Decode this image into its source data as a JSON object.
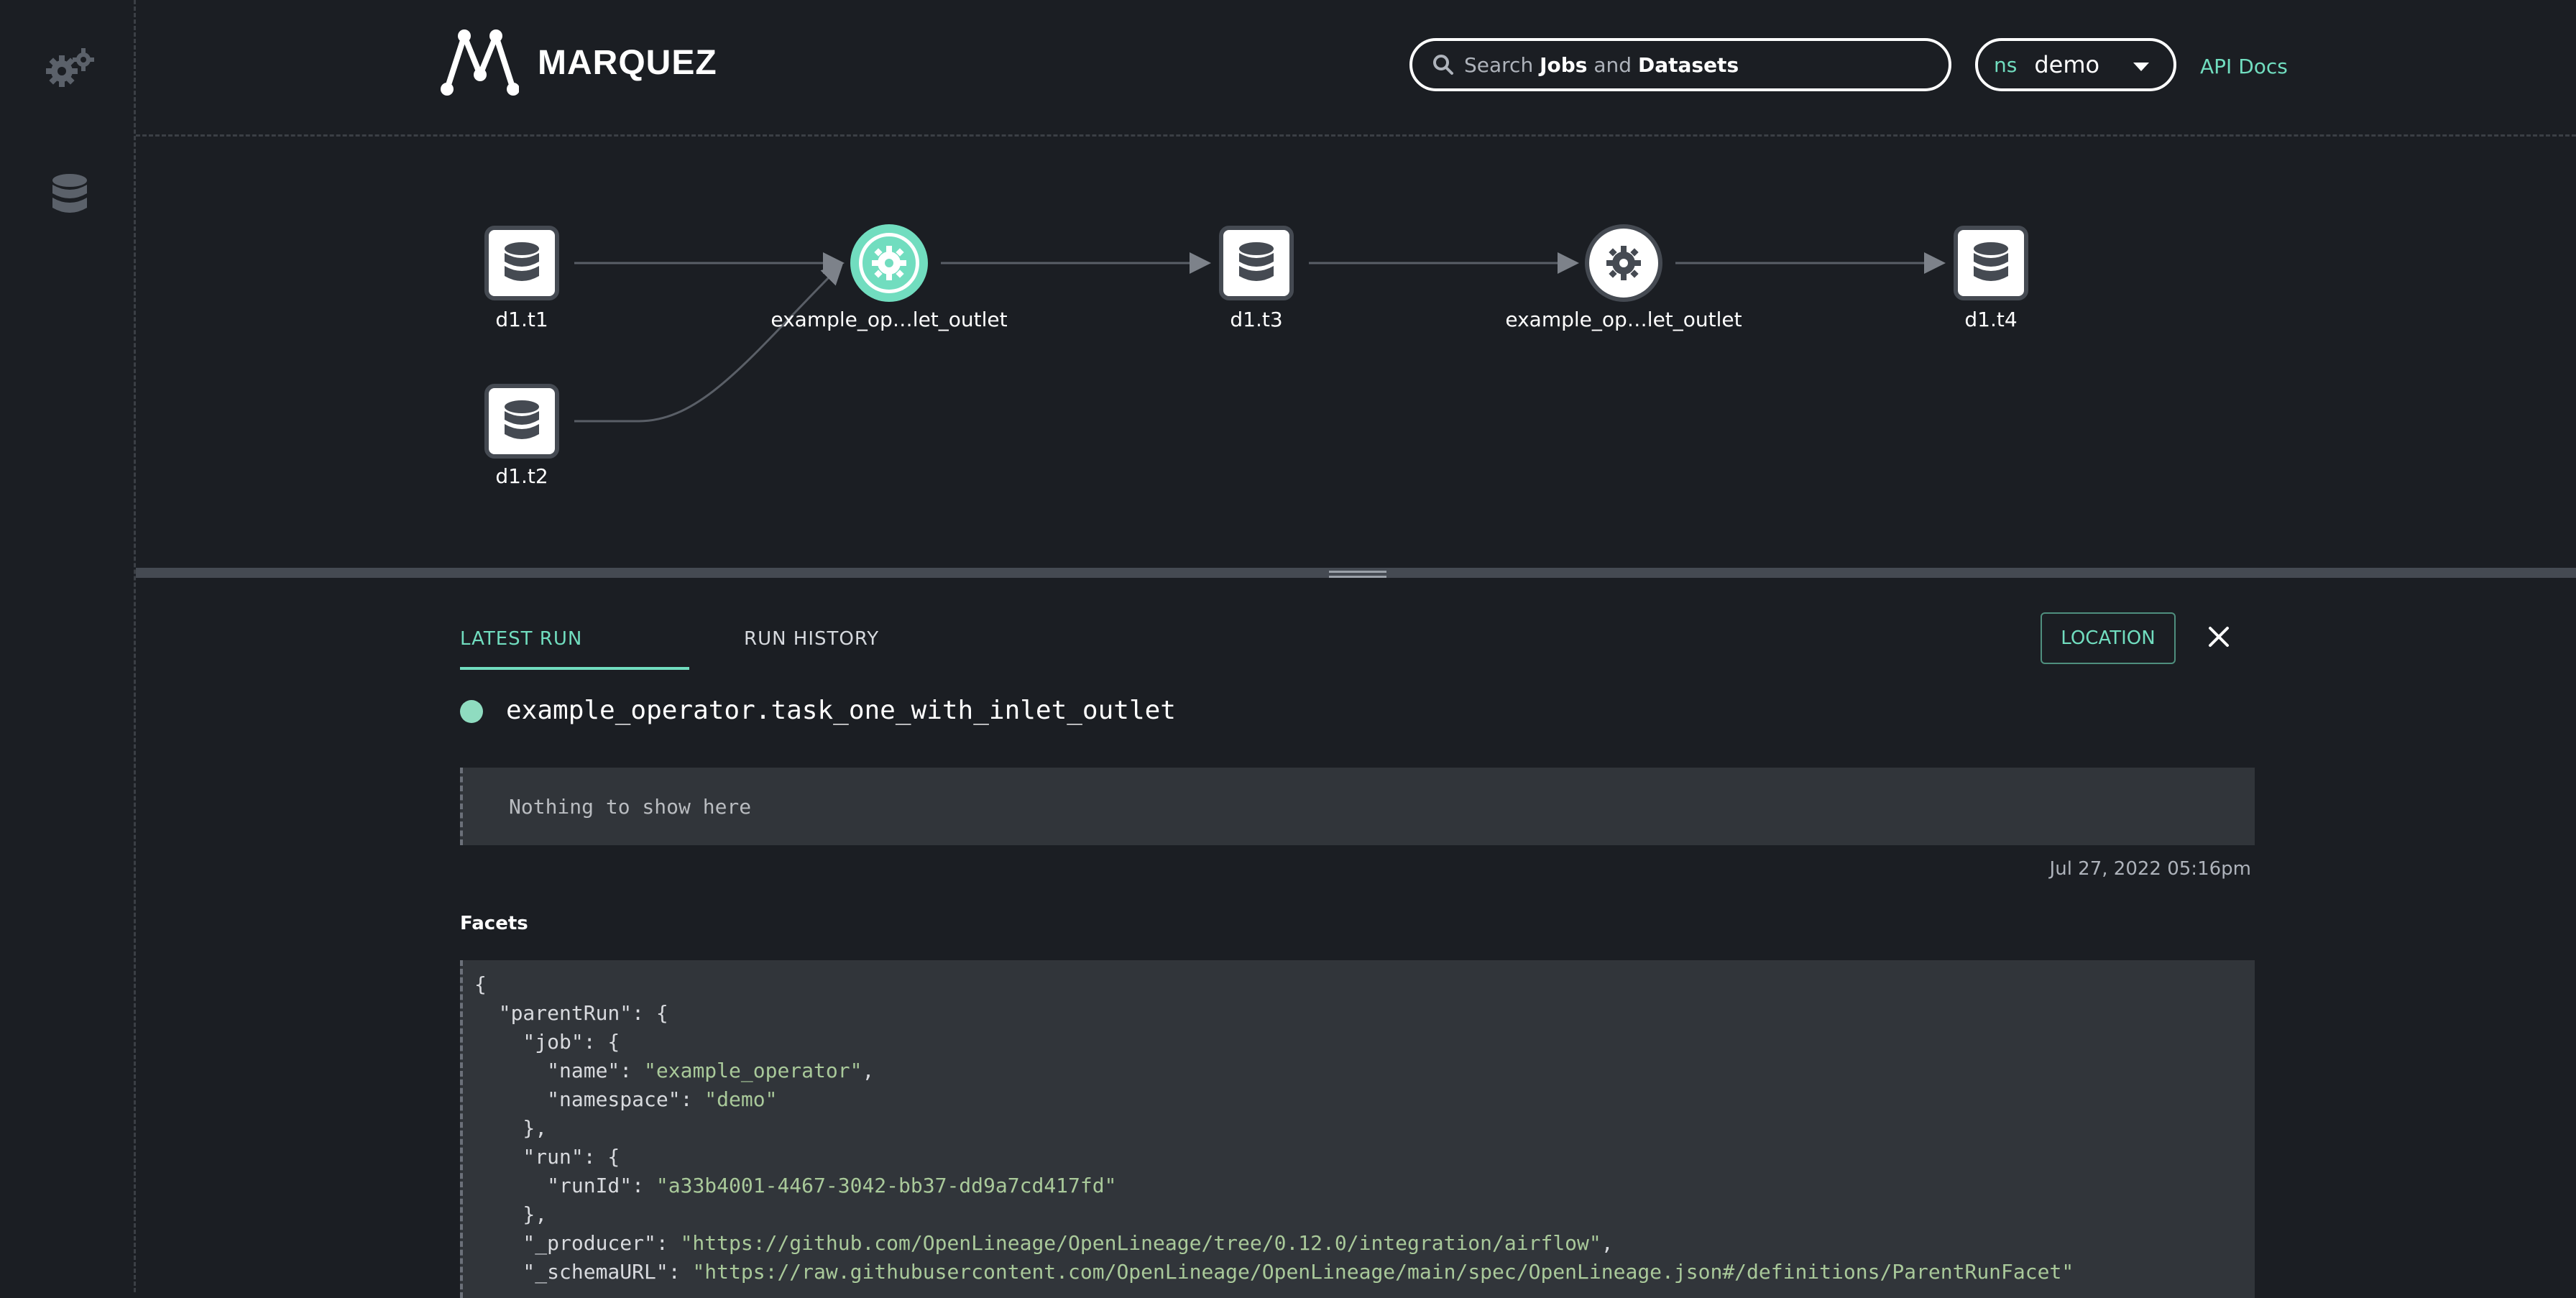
{
  "app": {
    "name": "MARQUEZ"
  },
  "search": {
    "prefix": "Search",
    "bold1": "Jobs",
    "mid": "and",
    "bold2": "Datasets"
  },
  "namespace": {
    "label": "ns",
    "value": "demo"
  },
  "header": {
    "api_docs": "API Docs"
  },
  "graph": {
    "nodes": [
      {
        "label": "d1.t1"
      },
      {
        "label": "d1.t2"
      },
      {
        "label": "example_op…let_outlet"
      },
      {
        "label": "d1.t3"
      },
      {
        "label": "example_op…let_outlet"
      },
      {
        "label": "d1.t4"
      }
    ]
  },
  "panel": {
    "tabs": [
      {
        "label": "LATEST RUN"
      },
      {
        "label": "RUN HISTORY"
      }
    ],
    "location_button": "LOCATION",
    "job_name": "example_operator.task_one_with_inlet_outlet",
    "empty_text": "Nothing to show here",
    "timestamp": "Jul 27, 2022 05:16pm",
    "facets_heading": "Facets",
    "facets_lines": [
      {
        "pre": "{",
        "str": "",
        "post": ""
      },
      {
        "pre": "  \"parentRun\": {",
        "str": "",
        "post": ""
      },
      {
        "pre": "    \"job\": {",
        "str": "",
        "post": ""
      },
      {
        "pre": "      \"name\": ",
        "str": "\"example_operator\"",
        "post": ","
      },
      {
        "pre": "      \"namespace\": ",
        "str": "\"demo\"",
        "post": ""
      },
      {
        "pre": "    },",
        "str": "",
        "post": ""
      },
      {
        "pre": "    \"run\": {",
        "str": "",
        "post": ""
      },
      {
        "pre": "      \"runId\": ",
        "str": "\"a33b4001-4467-3042-bb37-dd9a7cd417fd\"",
        "post": ""
      },
      {
        "pre": "    },",
        "str": "",
        "post": ""
      },
      {
        "pre": "    \"_producer\": ",
        "str": "\"https://github.com/OpenLineage/OpenLineage/tree/0.12.0/integration/airflow\"",
        "post": ","
      },
      {
        "pre": "    \"_schemaURL\": ",
        "str": "\"https://raw.githubusercontent.com/OpenLineage/OpenLineage/main/spec/OpenLineage.json#/definitions/ParentRunFacet\"",
        "post": ""
      }
    ]
  },
  "colors": {
    "accent": "#71ddbf",
    "background": "#1b1e23",
    "panel": "#31353a"
  },
  "icons": [
    "gears-icon",
    "database-icon",
    "search-icon",
    "gear-icon",
    "close-icon",
    "caret-down-icon"
  ]
}
